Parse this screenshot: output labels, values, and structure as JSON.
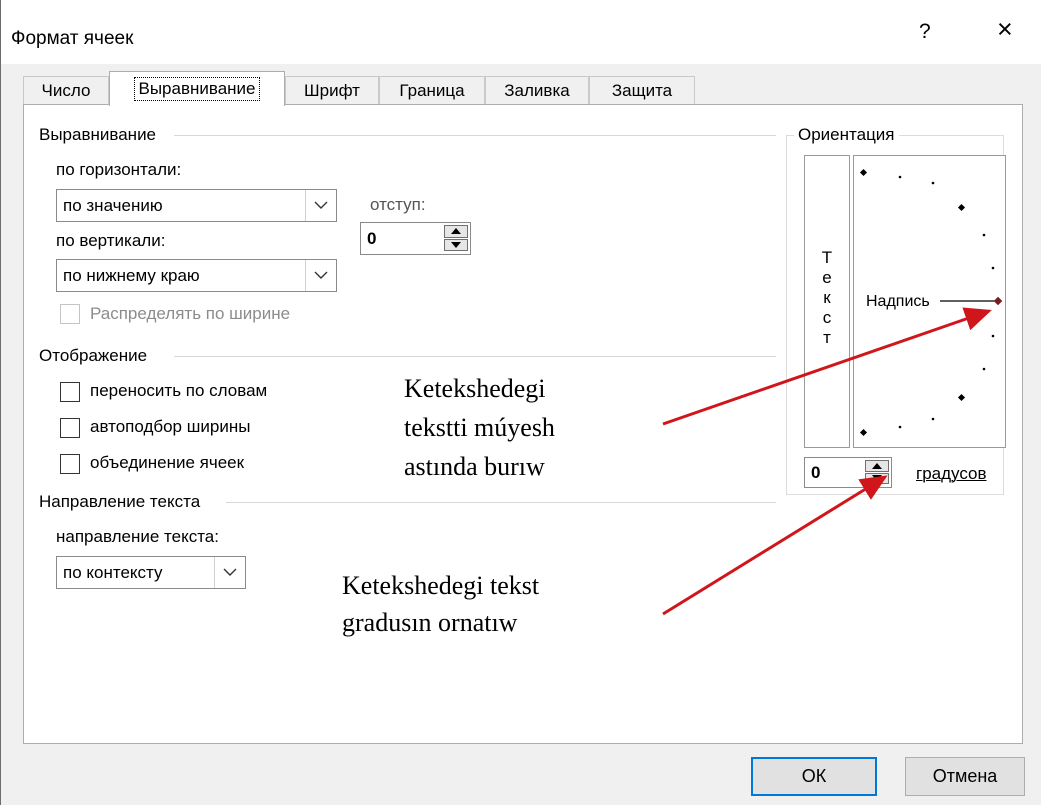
{
  "window": {
    "title": "Формат ячеек",
    "help": "?",
    "close": "×"
  },
  "tabs": [
    {
      "label": "Число"
    },
    {
      "label": "Выравнивание",
      "active": true
    },
    {
      "label": "Шрифт"
    },
    {
      "label": "Граница"
    },
    {
      "label": "Заливка"
    },
    {
      "label": "Защита"
    }
  ],
  "alignment": {
    "group_title": "Выравнивание",
    "horizontal_label": "по горизонтали:",
    "horizontal_value": "по значению",
    "indent_label": "отступ:",
    "indent_value": "0",
    "vertical_label": "по вертикали:",
    "vertical_value": "по нижнему краю",
    "distribute_label": "Распределять по ширине"
  },
  "display": {
    "group_title": "Отображение",
    "wrap_label": "переносить по словам",
    "shrink_label": "автоподбор ширины",
    "merge_label": "объединение ячеек"
  },
  "direction": {
    "group_title": "Направление текста",
    "label": "направление текста:",
    "value": "по контексту"
  },
  "orientation": {
    "group_title": "Ориентация",
    "vertical_text": [
      "Т",
      "е",
      "к",
      "с",
      "т"
    ],
    "dial_label": "Надпись",
    "degrees_value": "0",
    "degrees_label": "градусов"
  },
  "annotations": {
    "rotate_lines": [
      "Ketekshedegi",
      "tekstti múyesh",
      "astında burıw"
    ],
    "degree_lines": [
      "Ketekshedegi tekst",
      "gradusın ornatıw"
    ],
    "arrow_color": "#d0161b"
  },
  "buttons": {
    "ok": "ОК",
    "cancel": "Отмена"
  }
}
